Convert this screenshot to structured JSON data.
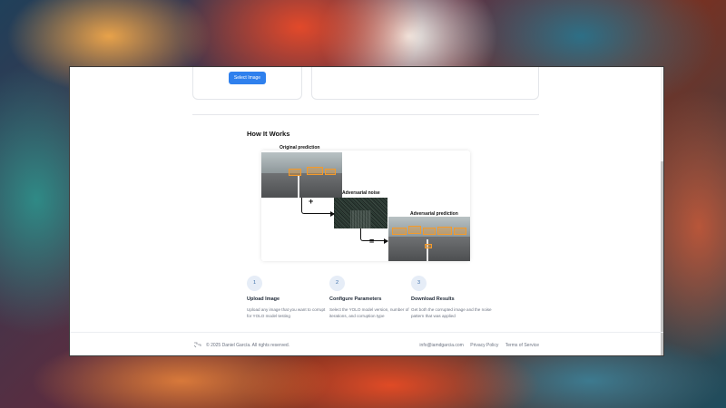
{
  "upload": {
    "select_button": "Select Image"
  },
  "how_it_works": {
    "title": "How It Works",
    "diagram": {
      "original_label": "Original prediction",
      "noise_label": "Adversarial noise",
      "adversarial_label": "Adversarial prediction",
      "plus_symbol": "+",
      "equals_symbol": "="
    },
    "steps": [
      {
        "number": "1",
        "title": "Upload Image",
        "description": "Upload any image that you want to corrupt for YOLO model testing"
      },
      {
        "number": "2",
        "title": "Configure Parameters",
        "description": "Select the YOLO model version, number of iterations, and corruption type"
      },
      {
        "number": "3",
        "title": "Download Results",
        "description": "Get both the corrupted image and the noise pattern that was applied"
      }
    ]
  },
  "footer": {
    "logo_icon": "logo-icon",
    "copyright": "© 2025 Daniel García. All rights reserved.",
    "email": "info@iamdgarcia.com",
    "privacy": "Privacy Policy",
    "terms": "Terms of Service"
  },
  "colors": {
    "accent": "#2f80ed",
    "step_circle_bg": "#e6edf7",
    "step_circle_text": "#3d6fa8"
  }
}
